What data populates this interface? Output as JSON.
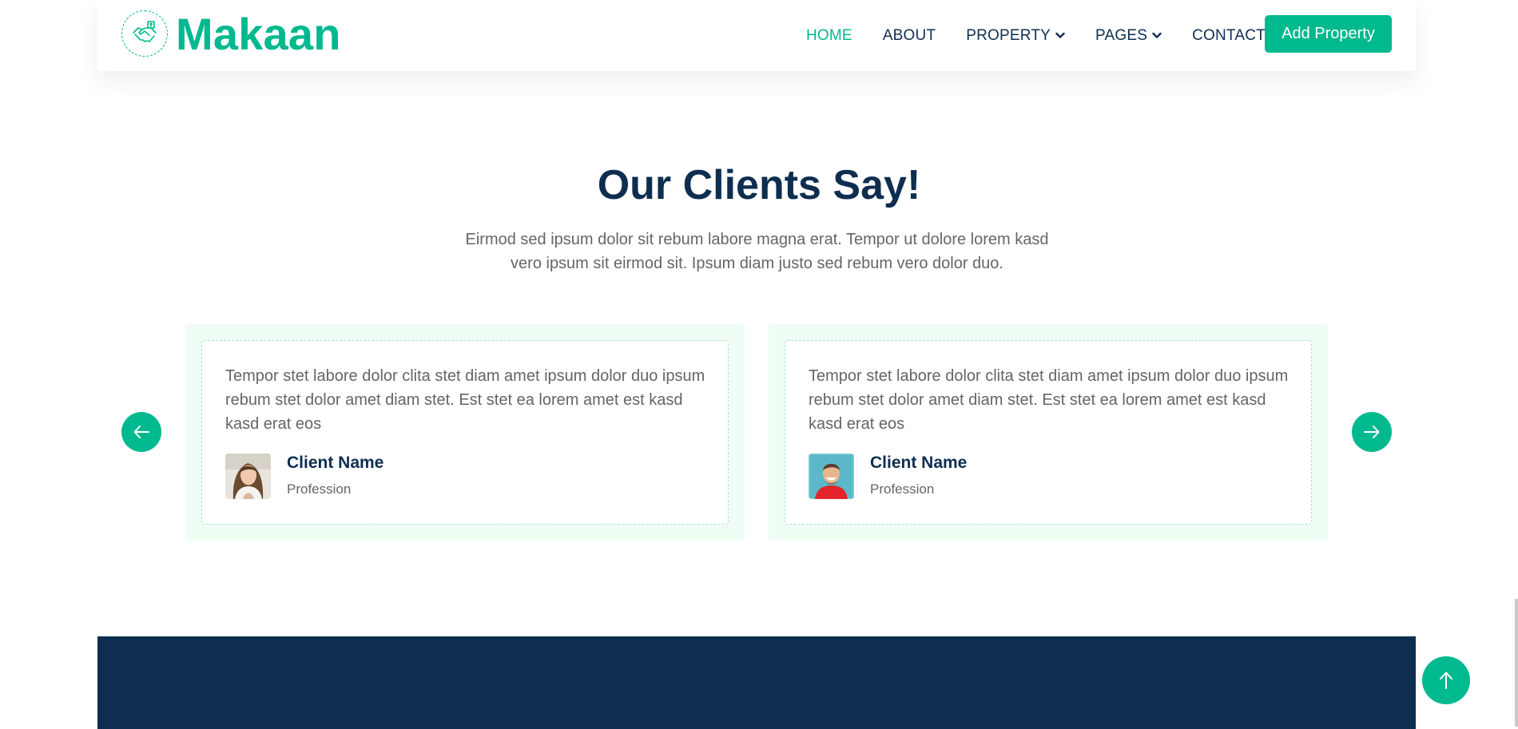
{
  "brand": {
    "name": "Makaan",
    "logo_icon": "handshake-icon",
    "accent": "#00b98e",
    "dark": "#0e2e50"
  },
  "nav": {
    "items": [
      {
        "label": "HOME",
        "active": true
      },
      {
        "label": "ABOUT",
        "active": false
      },
      {
        "label": "PROPERTY",
        "active": false,
        "dropdown": true
      },
      {
        "label": "PAGES",
        "active": false,
        "dropdown": true
      },
      {
        "label": "CONTACT",
        "active": false
      }
    ],
    "cta_label": "Add Property"
  },
  "testimonials": {
    "title": "Our Clients Say!",
    "subtitle": "Eirmod sed ipsum dolor sit rebum labore magna erat. Tempor ut dolore lorem kasd vero ipsum sit eirmod sit. Ipsum diam justo sed rebum vero dolor duo.",
    "prev_icon": "arrow-left-icon",
    "next_icon": "arrow-right-icon",
    "cards": [
      {
        "quote": "Tempor stet labore dolor clita stet diam amet ipsum dolor duo ipsum rebum stet dolor amet diam stet. Est stet ea lorem amet est kasd kasd erat eos",
        "name": "Client Name",
        "profession": "Profession"
      },
      {
        "quote": "Tempor stet labore dolor clita stet diam amet ipsum dolor duo ipsum rebum stet dolor amet diam stet. Est stet ea lorem amet est kasd kasd erat eos",
        "name": "Client Name",
        "profession": "Profession"
      }
    ]
  },
  "back_to_top_icon": "arrow-up-icon"
}
